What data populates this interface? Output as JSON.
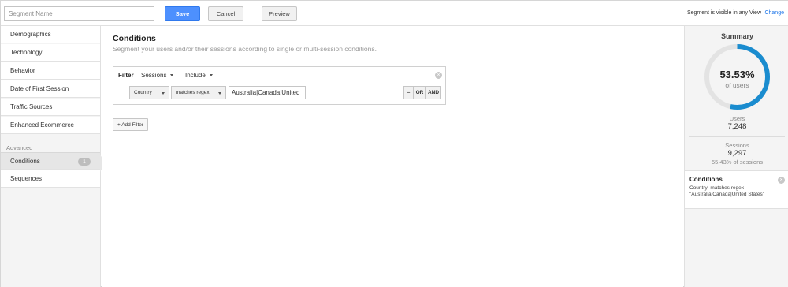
{
  "topbar": {
    "segment_name_placeholder": "Segment Name",
    "save_label": "Save",
    "cancel_label": "Cancel",
    "preview_label": "Preview",
    "visibility_text": "Segment is visible in any View",
    "change_label": "Change"
  },
  "sidebar": {
    "items": [
      {
        "label": "Demographics"
      },
      {
        "label": "Technology"
      },
      {
        "label": "Behavior"
      },
      {
        "label": "Date of First Session"
      },
      {
        "label": "Traffic Sources"
      },
      {
        "label": "Enhanced Ecommerce"
      }
    ],
    "advanced_heading": "Advanced",
    "advanced_items": [
      {
        "label": "Conditions",
        "badge": "1",
        "active": true
      },
      {
        "label": "Sequences"
      }
    ]
  },
  "main": {
    "title": "Conditions",
    "subtitle": "Segment your users and/or their sessions according to single or multi-session conditions.",
    "filter": {
      "label": "Filter",
      "scope": "Sessions",
      "mode": "Include",
      "dimension": "Country",
      "operator": "matches regex",
      "value": "Australia|Canada|United",
      "minus_label": "–",
      "or_label": "OR",
      "and_label": "AND"
    },
    "add_filter_label": "+ Add Filter"
  },
  "summary": {
    "title": "Summary",
    "percent": "53.53%",
    "percent_sub": "of users",
    "percent_value": 0.5353,
    "users_label": "Users",
    "users_value": "7,248",
    "sessions_label": "Sessions",
    "sessions_value": "9,297",
    "sessions_pct": "55.43% of sessions",
    "conditions_title": "Conditions",
    "conditions_line1": "Country: matches regex",
    "conditions_line2": "\"Australia|Canada|United States\""
  },
  "colors": {
    "accent": "#4d90fe",
    "donut_fill": "#1a8ccf",
    "donut_track": "#e3e3e3",
    "link": "#1a73e8"
  }
}
